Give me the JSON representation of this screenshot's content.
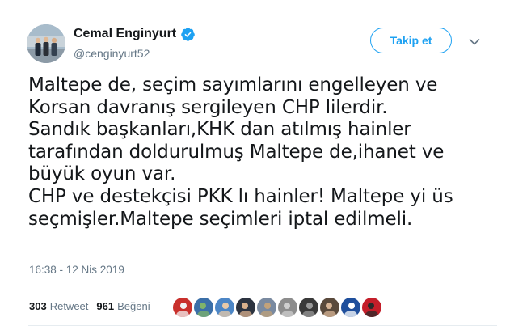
{
  "author": {
    "display_name": "Cemal Enginyurt",
    "handle": "@cenginyurt52",
    "verified": true,
    "avatar": "group-photo-avatar"
  },
  "follow_button_label": "Takip et",
  "caret_icon": "chevron-down-icon",
  "tweet_text_lines": [
    "Maltepe de, seçim sayımlarını engelleyen ve",
    "Korsan davranış sergileyen CHP lilerdir.",
    "Sandık başkanları,KHK dan atılmış hainler",
    "tarafından doldurulmuş Maltepe de,ihanet ve",
    "büyük oyun var.",
    "CHP ve destekçisi PKK lı hainler! Maltepe yi üs",
    "seçmişler.Maltepe seçimleri iptal edilmeli."
  ],
  "timestamp": "16:38 - 12 Nis 2019",
  "stats": {
    "retweet_count": "303",
    "retweet_label": "Retweet",
    "like_count": "961",
    "like_label": "Beğeni"
  },
  "colors": {
    "accent": "#1da1f2",
    "secondary_text": "#657786",
    "primary_text": "#14171a",
    "divider": "#e6ecf0"
  },
  "liker_avatars": [
    {
      "name": "liker-avatar-red",
      "color": "#c9302c",
      "accent": "#f2f2f2"
    },
    {
      "name": "liker-avatar-stadium",
      "color": "#3b6fa8",
      "accent": "#7fb36a"
    },
    {
      "name": "liker-avatar-person-blue",
      "color": "#4c86c6",
      "accent": "#e8c9a8"
    },
    {
      "name": "liker-avatar-person-dark",
      "color": "#2c3340",
      "accent": "#d9b08c"
    },
    {
      "name": "liker-avatar-landscape",
      "color": "#7a8aa0",
      "accent": "#c2a27a"
    },
    {
      "name": "liker-avatar-grey",
      "color": "#8d8d8d",
      "accent": "#cfcfcf"
    },
    {
      "name": "liker-avatar-mono",
      "color": "#3a3a3a",
      "accent": "#9a9a9a"
    },
    {
      "name": "liker-avatar-portrait",
      "color": "#5a4a3c",
      "accent": "#d8b596"
    },
    {
      "name": "liker-avatar-emblem",
      "color": "#1f4f9c",
      "accent": "#ffffff"
    },
    {
      "name": "liker-avatar-flag",
      "color": "#c41e2a",
      "accent": "#2a2a2a"
    }
  ]
}
